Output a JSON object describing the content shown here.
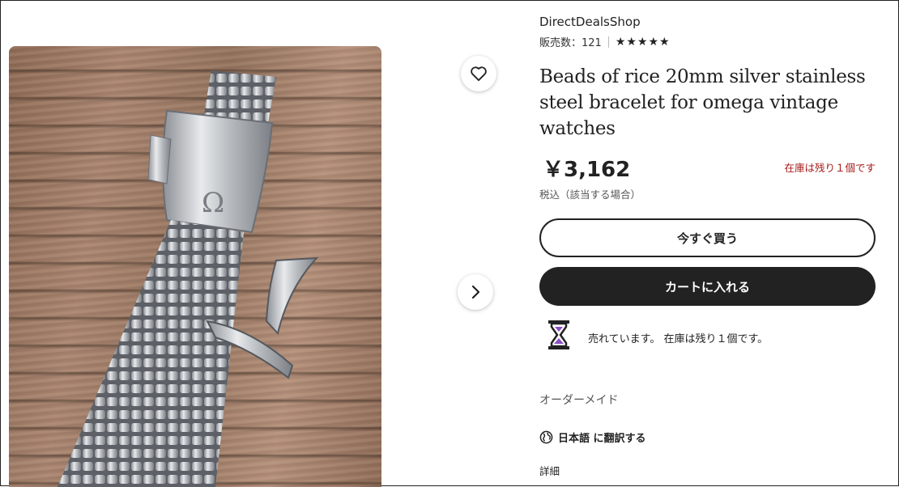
{
  "shop": {
    "name": "DirectDealsShop",
    "sales_label": "販売数：121",
    "stars": "★★★★★"
  },
  "product": {
    "title": "Beads of rice 20mm silver stainless steel bracelet for omega vintage watches",
    "price": "￥3,162",
    "stock_notice": "在庫は残り１個です",
    "tax_note": "税込（該当する場合）",
    "selling_message": "売れています。 在庫は残り１個です。",
    "custom_label": "オーダーメイド",
    "translate_link": "日本語 に翻訳する",
    "details_heading": "詳細"
  },
  "actions": {
    "buy_now": "今すぐ買う",
    "add_to_cart": "カートに入れる"
  },
  "icons": {
    "favorite": "heart-icon",
    "next": "chevron-right-icon",
    "urgency": "hourglass-icon",
    "translate": "globe-icon",
    "rating": "star-icon"
  },
  "colors": {
    "stock_warning": "#a61a1a",
    "primary_button": "#222222",
    "hourglass_sand": "#8a4fc7"
  }
}
